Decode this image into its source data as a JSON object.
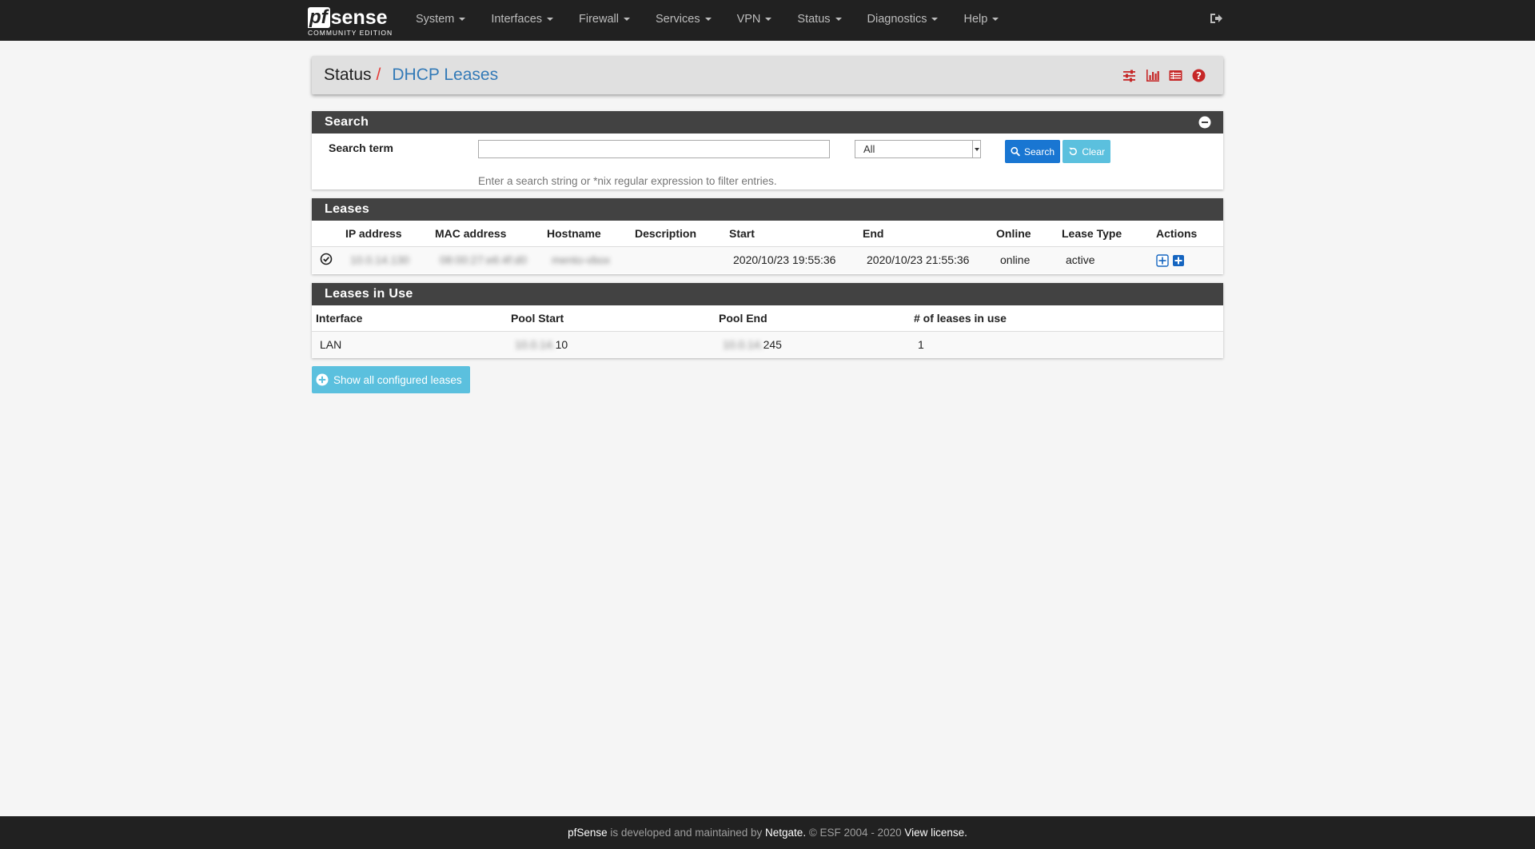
{
  "brand": {
    "pf": "pf",
    "sense": "sense",
    "edition": "COMMUNITY EDITION"
  },
  "nav": {
    "items": [
      {
        "label": "System"
      },
      {
        "label": "Interfaces"
      },
      {
        "label": "Firewall"
      },
      {
        "label": "Services"
      },
      {
        "label": "VPN"
      },
      {
        "label": "Status"
      },
      {
        "label": "Diagnostics"
      },
      {
        "label": "Help"
      }
    ],
    "logout_icon": "sign-out-icon"
  },
  "header": {
    "crumb1": "Status",
    "separator": "/",
    "crumb2": "DHCP Leases",
    "icons": [
      "sliders-icon",
      "bar-chart-icon",
      "log-list-icon",
      "help-icon"
    ]
  },
  "search": {
    "title": "Search",
    "term_label": "Search term",
    "input_value": "",
    "select_value": "All",
    "search_button": "Search",
    "clear_button": "Clear",
    "help": "Enter a search string or *nix regular expression to filter entries."
  },
  "leases": {
    "title": "Leases",
    "columns": [
      "IP address",
      "MAC address",
      "Hostname",
      "Description",
      "Start",
      "End",
      "Online",
      "Lease Type",
      "Actions"
    ],
    "rows": [
      {
        "ip": "10.0.14.130",
        "mac": "08:00:27:e6:4f:d0",
        "hostname": "mento-vbox",
        "description": "",
        "start": "2020/10/23 19:55:36",
        "end": "2020/10/23 21:55:36",
        "online": "online",
        "lease_type": "active"
      }
    ]
  },
  "leases_in_use": {
    "title": "Leases in Use",
    "columns": [
      "Interface",
      "Pool Start",
      "Pool End",
      "# of leases in use"
    ],
    "rows": [
      {
        "interface": "LAN",
        "pool_start_prefix": "10.0.14.",
        "pool_start_suffix": "10",
        "pool_end_prefix": "10.0.14.",
        "pool_end_suffix": "245",
        "count": "1"
      }
    ]
  },
  "show_all_button": "Show all configured leases",
  "footer": {
    "brand": "pfSense",
    "text1": " is developed and maintained by ",
    "company": "Netgate.",
    "text2": " © ESF 2004 - 2020 ",
    "license": "View license."
  },
  "colors": {
    "navbar": "#212121",
    "panel_heading": "#424242",
    "primary": "#1976d2",
    "info": "#5bc0de",
    "link": "#337ab7",
    "danger": "#e53935",
    "icon_red": "#c62828"
  }
}
